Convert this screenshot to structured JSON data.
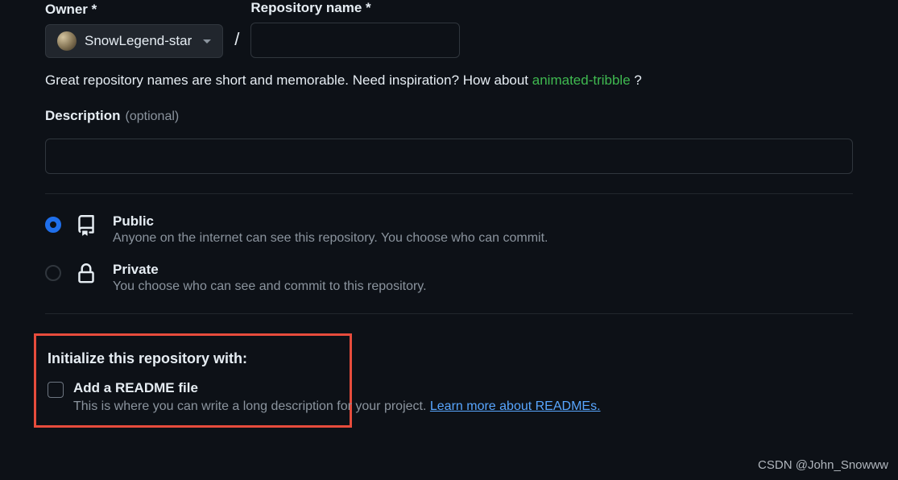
{
  "owner": {
    "label": "Owner *",
    "name": "SnowLegend-star"
  },
  "repo": {
    "label": "Repository name *"
  },
  "hint": {
    "prefix": "Great repository names are short and memorable. Need inspiration? How about ",
    "suggestion": "animated-tribble",
    "suffix": " ?"
  },
  "description": {
    "label": "Description",
    "optional": "(optional)"
  },
  "visibility": {
    "public": {
      "title": "Public",
      "desc": "Anyone on the internet can see this repository. You choose who can commit."
    },
    "private": {
      "title": "Private",
      "desc": "You choose who can see and commit to this repository."
    }
  },
  "init": {
    "title": "Initialize this repository with:",
    "readme": {
      "title": "Add a README file",
      "desc": "This is where you can write a long description for your project. ",
      "link": "Learn more about READMEs."
    }
  },
  "watermark": "CSDN @John_Snowww"
}
